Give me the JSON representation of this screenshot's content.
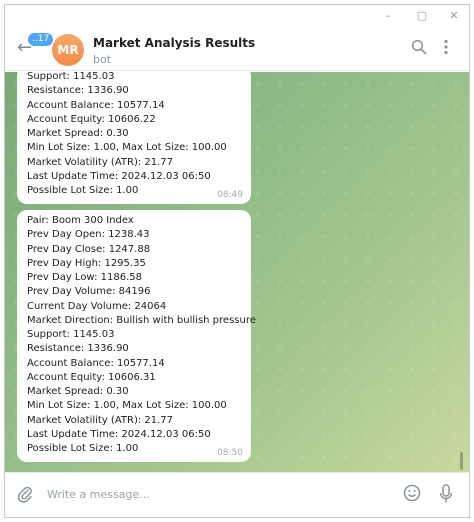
{
  "window": {
    "minimize": "–",
    "maximize": "▢",
    "close": "✕"
  },
  "header": {
    "badge": "17",
    "avatar_initials": "MR",
    "avatar_color": "#f28a4a",
    "title": "Market Analysis Results",
    "subtitle": "bot",
    "icons": [
      "search-icon",
      "more-vertical-icon"
    ]
  },
  "messages": [
    {
      "lines": [
        "Support: 1145.03",
        "Resistance: 1336.90",
        "Account Balance: 10577.14",
        "Account Equity: 10606.22",
        "Market Spread: 0.30",
        "Min Lot Size: 1.00, Max Lot Size: 100.00",
        "Market Volatility (ATR): 21.77",
        "Last Update Time: 2024.12.03 06:50",
        "Possible Lot Size: 1.00"
      ],
      "time": "08:49"
    },
    {
      "lines": [
        "Pair: Boom 300 Index",
        "Prev Day Open: 1238.43",
        "Prev Day Close: 1247.88",
        "Prev Day High: 1295.35",
        "Prev Day Low: 1186.58",
        "Prev Day Volume: 84196",
        "Current Day Volume: 24064",
        "Market Direction: Bullish with bullish pressure",
        "Support: 1145.03",
        "Resistance: 1336.90",
        "Account Balance: 10577.14",
        "Account Equity: 10606.31",
        "Market Spread: 0.30",
        "Min Lot Size: 1.00, Max Lot Size: 100.00",
        "Market Volatility (ATR): 21.77",
        "Last Update Time: 2024.12.03 06:50",
        "Possible Lot Size: 1.00"
      ],
      "time": "08:50"
    }
  ],
  "composer": {
    "placeholder": "Write a message...",
    "icons": [
      "paperclip-icon",
      "emoji-icon",
      "microphone-icon"
    ]
  },
  "colors": {
    "accent": "#4ea4f6",
    "chat_bg": "#8dba85"
  }
}
